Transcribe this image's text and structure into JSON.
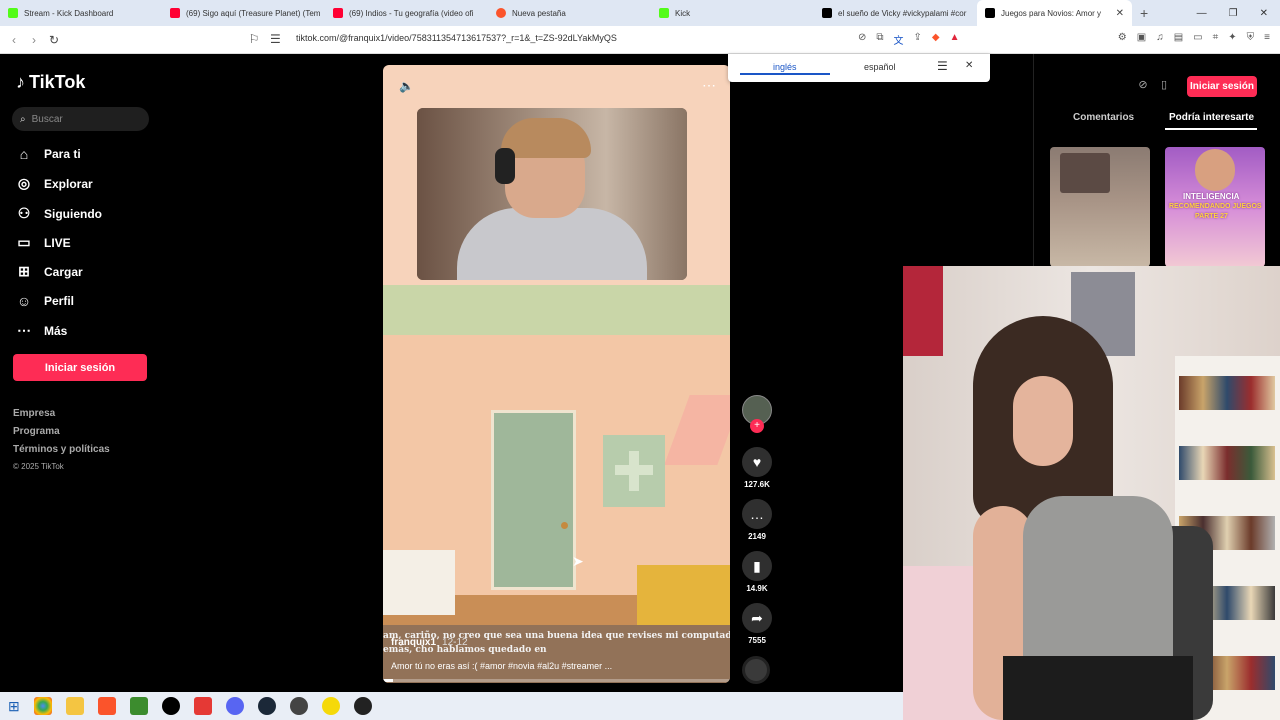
{
  "browser": {
    "tabs": [
      {
        "title": "Stream - Kick Dashboard",
        "color": "#53fc18"
      },
      {
        "title": "(69) Sigo aquí (Treasure Planet) (Tem",
        "color": "#ff0033"
      },
      {
        "title": "(69) Indios - Tu geografía (video ofi",
        "color": "#ff0033"
      },
      {
        "title": "Nueva pestaña",
        "color": "#fb542b"
      },
      {
        "title": "Kick",
        "color": "#53fc18"
      },
      {
        "title": "el sueño de Vicky #vickypalami #cor",
        "color": "#000000"
      },
      {
        "title": "Juegos para Novios: Amor y",
        "color": "#000000",
        "active": true
      }
    ],
    "url": "tiktok.com/@franquix1/video/758311354713617537?_r=1&_t=ZS-92dLYakMyQS"
  },
  "translate": {
    "options": [
      "inglés",
      "español"
    ],
    "selected": "inglés"
  },
  "sidebar": {
    "logo": "TikTok",
    "search_placeholder": "Buscar",
    "items": [
      {
        "label": "Para ti",
        "icon": "home-icon"
      },
      {
        "label": "Explorar",
        "icon": "compass-icon"
      },
      {
        "label": "Siguiendo",
        "icon": "following-icon"
      },
      {
        "label": "LIVE",
        "icon": "live-icon"
      },
      {
        "label": "Cargar",
        "icon": "upload-icon"
      },
      {
        "label": "Perfil",
        "icon": "profile-icon"
      },
      {
        "label": "Más",
        "icon": "more-icon"
      }
    ],
    "login": "Iniciar sesión",
    "footer": [
      "Empresa",
      "Programa",
      "Términos y políticas"
    ],
    "copyright": "© 2025 TikTok"
  },
  "video": {
    "subtitle_line1": "am, cariño, no creo que sea una buena idea que revises mi computadora. T",
    "subtitle_line2": "emás, cho hablamos quedado en",
    "author": "franquix1",
    "date": "12-12",
    "description": "Amor tú no eras así :( #amor #novia #al2u #streamer ...",
    "progress": 0.03
  },
  "actions": {
    "likes": "127.6K",
    "comments": "2149",
    "saves": "14.9K",
    "shares": "7555"
  },
  "right_panel": {
    "login": "Iniciar sesión",
    "tabs": [
      "Comentarios",
      "Podría interesarte"
    ],
    "selected_tab": "Podría interesarte",
    "thumb2_text": [
      "INTELIGENCIA",
      "RECOMENDANDO JUEGOS",
      "PARTE 27"
    ]
  },
  "colors": {
    "accent": "#fe2c55",
    "translate_blue": "#1a56c7"
  }
}
